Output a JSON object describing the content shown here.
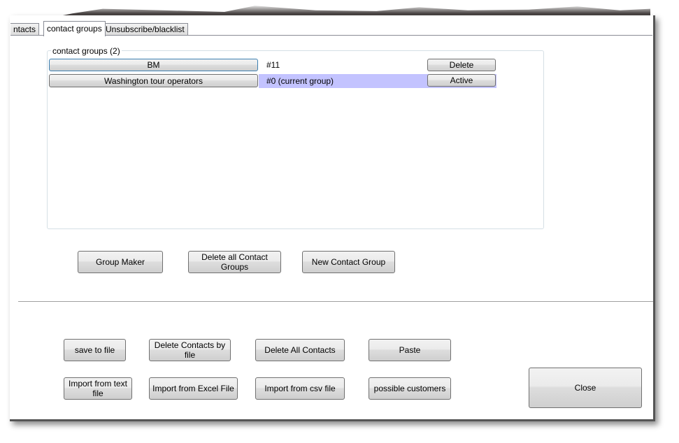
{
  "tabs": [
    {
      "label": "ntacts"
    },
    {
      "label": "contact groups",
      "active": true
    },
    {
      "label": "Unsubscribe/blacklist"
    }
  ],
  "group_box": {
    "title": "contact groups (2)",
    "rows": [
      {
        "name": "BM",
        "info": "#11",
        "action": "Delete",
        "highlight": false
      },
      {
        "name": "Washington tour operators",
        "info": "#0 (current group)",
        "action": "Active",
        "highlight": true
      }
    ]
  },
  "group_buttons": [
    "Group Maker",
    "Delete all Contact Groups",
    "New Contact Group"
  ],
  "bottom_buttons": {
    "row1": [
      "save to file",
      "Delete Contacts by file",
      "Delete All Contacts",
      "Paste"
    ],
    "row2": [
      "Import from text file",
      "Import from Excel File",
      "Import from csv file",
      "possible customers"
    ],
    "close": "Close"
  },
  "colors": {
    "highlight": "#c3c3ff",
    "focus_border": "#3c7fb1"
  }
}
